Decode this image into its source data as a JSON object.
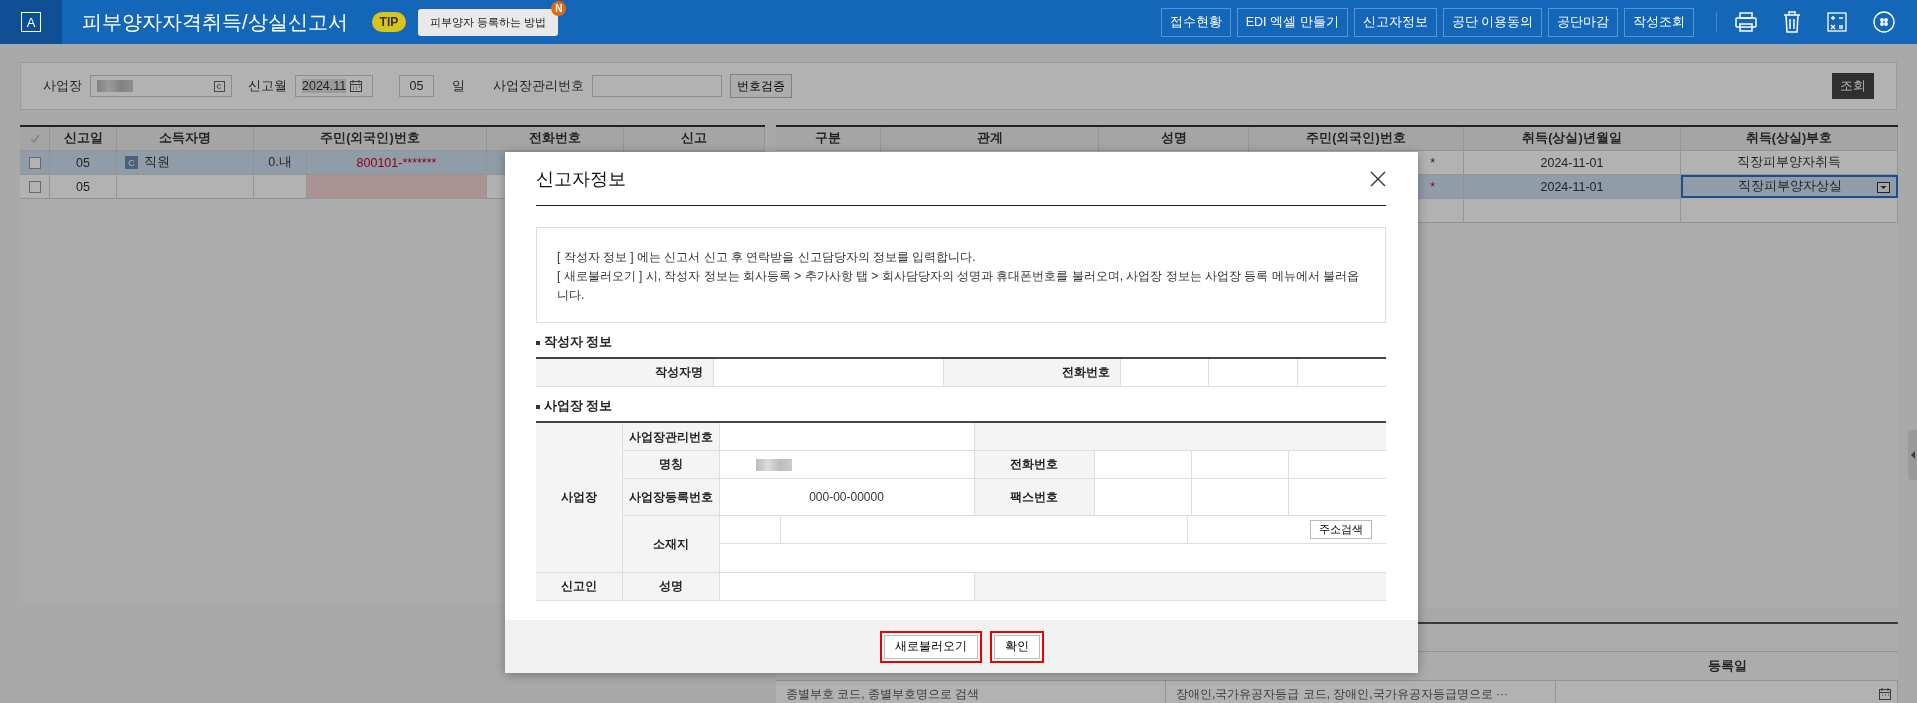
{
  "header": {
    "logo": "A",
    "title": "피부양자자격취득/상실신고서",
    "tip": {
      "badge": "TIP",
      "text": "피부양자 등록하는 방법",
      "new_badge": "N"
    },
    "buttons": [
      "접수현황",
      "EDI 엑셀 만들기",
      "신고자정보",
      "공단 이용동의",
      "공단마감",
      "작성조회"
    ]
  },
  "filter": {
    "workplace": {
      "label": "사업장"
    },
    "month": {
      "label": "신고월",
      "value": "2024.11"
    },
    "day": {
      "value": "05",
      "label": "일"
    },
    "mgmt_no": {
      "label": "사업장관리번호"
    },
    "verify_button": "번호검증",
    "search_button": "조회"
  },
  "left_table": {
    "columns": [
      "신고일",
      "소득자명",
      "주민(외국인)번호",
      "전화번호",
      "신고"
    ],
    "rows": [
      {
        "selected": true,
        "checked": false,
        "error": false,
        "date": "05",
        "badge": "C",
        "name": "직원",
        "nationality": "0.내",
        "resident_no": "800101-*******"
      },
      {
        "selected": false,
        "checked": false,
        "error": true,
        "date": "05"
      }
    ]
  },
  "right_table": {
    "columns": [
      "구분",
      "관계",
      "성명",
      "주민(외국인)번호",
      "취득(상실)년월일",
      "취득(상실)부호"
    ],
    "rows": [
      {
        "selected": false,
        "error": false,
        "resident_tail": "*",
        "date": "2024-11-01",
        "code": "직장피부양자취득"
      },
      {
        "selected": true,
        "error": true,
        "resident_tail": "*",
        "date": "2024-11-01",
        "code": "직장피부양자상실"
      }
    ]
  },
  "bottom_table": {
    "date_column": "등록일",
    "search_hints": [
      "종별부호 코드, 종별부호명으로 검색",
      "장애인,국가유공자등급 코드, 장애인,국가유공자등급명으로 ···"
    ]
  },
  "dialog": {
    "title": "신고자정보",
    "notice": [
      "[ 작성자 정보 ] 에는 신고서 신고 후 연락받을 신고담당자의 정보를 입력합니다.",
      "[ 새로불러오기 ] 시, 작성자 정보는 회사등록 > 추가사항 탭 > 회사담당자의 성명과 휴대폰번호를 불러오며, 사업장 정보는 사업장 등록 메뉴에서 불러옵니다."
    ],
    "writer_section": {
      "title": "작성자 정보",
      "name_label": "작성자명",
      "phone_label": "전화번호"
    },
    "workplace_section": {
      "title": "사업장 정보",
      "group_label": "사업장",
      "mgmt_no_label": "사업장관리번호",
      "name_label": "명칭",
      "phone_label": "전화번호",
      "reg_no_label": "사업장등록번호",
      "reg_no_value": "000-00-00000",
      "fax_label": "팩스번호",
      "address_label": "소재지",
      "address_search_button": "주소검색",
      "reporter_label": "신고인",
      "reporter_name_label": "성명"
    },
    "buttons": [
      {
        "label": "새로불러오기",
        "highlighted": true
      },
      {
        "label": "확인",
        "highlighted": true
      }
    ]
  }
}
